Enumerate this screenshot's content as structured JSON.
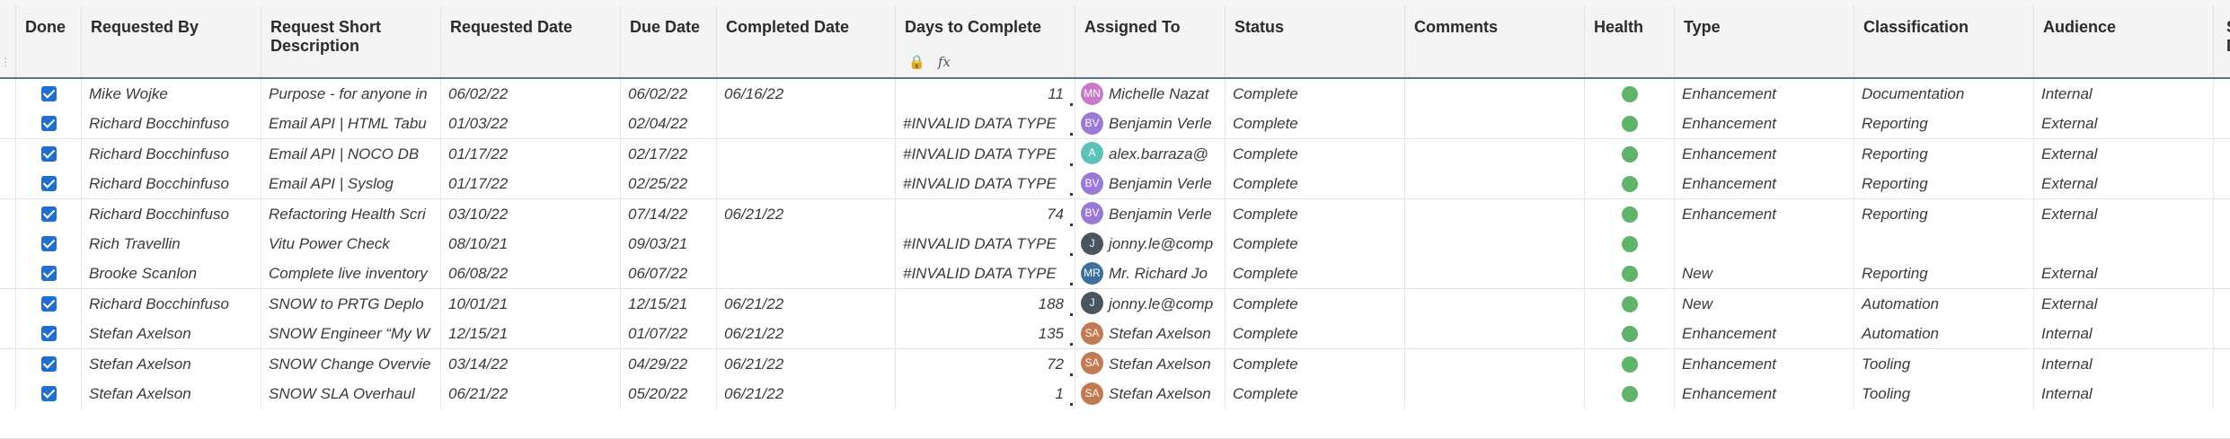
{
  "header": {
    "done": "Done",
    "requested_by": "Requested By",
    "short_desc": "Request Short Description",
    "requested_date": "Requested Date",
    "due_date": "Due Date",
    "completed_date": "Completed Date",
    "days_to_complete": "Days to Complete",
    "assigned_to": "Assigned To",
    "status": "Status",
    "comments": "Comments",
    "health": "Health",
    "type": "Type",
    "classification": "Classification",
    "audience": "Audience",
    "extra": "S D",
    "lock_icon": "🔒",
    "formula_icon": "fx"
  },
  "colors": {
    "checkbox": "#1f6fd1",
    "health_green": "#5fb36a",
    "header_rule": "#5b7590"
  },
  "rows": [
    {
      "requested_by": "Mike Wojke",
      "desc": "Purpose - for anyone in",
      "req_date": "06/02/22",
      "due": "06/02/22",
      "completed": "06/16/22",
      "days": "11",
      "initials": "MN",
      "avatar_color": "#c979c6",
      "assigned": "Michelle Nazat",
      "status": "Complete",
      "type": "Enhancement",
      "class": "Documentation",
      "audience": "Internal"
    },
    {
      "requested_by": "Richard Bocchinfuso",
      "desc": "Email API | HTML Tabu",
      "req_date": "01/03/22",
      "due": "02/04/22",
      "completed": "",
      "days": "#INVALID DATA TYPE",
      "initials": "BV",
      "avatar_color": "#9a7ad6",
      "assigned": "Benjamin Verle",
      "status": "Complete",
      "type": "Enhancement",
      "class": "Reporting",
      "audience": "External"
    },
    {
      "requested_by": "Richard Bocchinfuso",
      "desc": "Email API | NOCO DB",
      "req_date": "01/17/22",
      "due": "02/17/22",
      "completed": "",
      "days": "#INVALID DATA TYPE",
      "initials": "A",
      "avatar_color": "#5cc3bb",
      "assigned": "alex.barraza@",
      "status": "Complete",
      "type": "Enhancement",
      "class": "Reporting",
      "audience": "External"
    },
    {
      "requested_by": "Richard Bocchinfuso",
      "desc": "Email API | Syslog",
      "req_date": "01/17/22",
      "due": "02/25/22",
      "completed": "",
      "days": "#INVALID DATA TYPE",
      "initials": "BV",
      "avatar_color": "#9a7ad6",
      "assigned": "Benjamin Verle",
      "status": "Complete",
      "type": "Enhancement",
      "class": "Reporting",
      "audience": "External"
    },
    {
      "requested_by": "Richard Bocchinfuso",
      "desc": "Refactoring Health Scri",
      "req_date": "03/10/22",
      "due": "07/14/22",
      "completed": "06/21/22",
      "days": "74",
      "initials": "BV",
      "avatar_color": "#9a7ad6",
      "assigned": "Benjamin Verle",
      "status": "Complete",
      "type": "Enhancement",
      "class": "Reporting",
      "audience": "External"
    },
    {
      "requested_by": "Rich Travellin",
      "desc": "Vitu Power Check",
      "req_date": "08/10/21",
      "due": "09/03/21",
      "completed": "",
      "days": "#INVALID DATA TYPE",
      "initials": "J",
      "avatar_color": "#4a5560",
      "assigned": "jonny.le@comp",
      "status": "Complete",
      "type": "",
      "class": "",
      "audience": ""
    },
    {
      "requested_by": "Brooke Scanlon",
      "desc": "Complete live inventory",
      "req_date": "06/08/22",
      "due": "06/07/22",
      "completed": "",
      "days": "#INVALID DATA TYPE",
      "initials": "MR",
      "avatar_color": "#3f6f9b",
      "assigned": "Mr. Richard Jo",
      "status": "Complete",
      "type": "New",
      "class": "Reporting",
      "audience": "External"
    },
    {
      "requested_by": "Richard Bocchinfuso",
      "desc": "SNOW to PRTG Deplo",
      "req_date": "10/01/21",
      "due": "12/15/21",
      "completed": "06/21/22",
      "days": "188",
      "initials": "J",
      "avatar_color": "#4a5560",
      "assigned": "jonny.le@comp",
      "status": "Complete",
      "type": "New",
      "class": "Automation",
      "audience": "External"
    },
    {
      "requested_by": "Stefan Axelson",
      "desc": "SNOW Engineer “My W",
      "req_date": "12/15/21",
      "due": "01/07/22",
      "completed": "06/21/22",
      "days": "135",
      "initials": "SA",
      "avatar_color": "#c27a52",
      "assigned": "Stefan Axelson",
      "status": "Complete",
      "type": "Enhancement",
      "class": "Automation",
      "audience": "Internal"
    },
    {
      "requested_by": "Stefan Axelson",
      "desc": "SNOW Change Overvie",
      "req_date": "03/14/22",
      "due": "04/29/22",
      "completed": "06/21/22",
      "days": "72",
      "initials": "SA",
      "avatar_color": "#c27a52",
      "assigned": "Stefan Axelson",
      "status": "Complete",
      "type": "Enhancement",
      "class": "Tooling",
      "audience": "Internal"
    },
    {
      "requested_by": "Stefan Axelson",
      "desc": "SNOW SLA Overhaul",
      "req_date": "06/21/22",
      "due": "05/20/22",
      "completed": "06/21/22",
      "days": "1",
      "initials": "SA",
      "avatar_color": "#c27a52",
      "assigned": "Stefan Axelson",
      "status": "Complete",
      "type": "Enhancement",
      "class": "Tooling",
      "audience": "Internal"
    }
  ]
}
